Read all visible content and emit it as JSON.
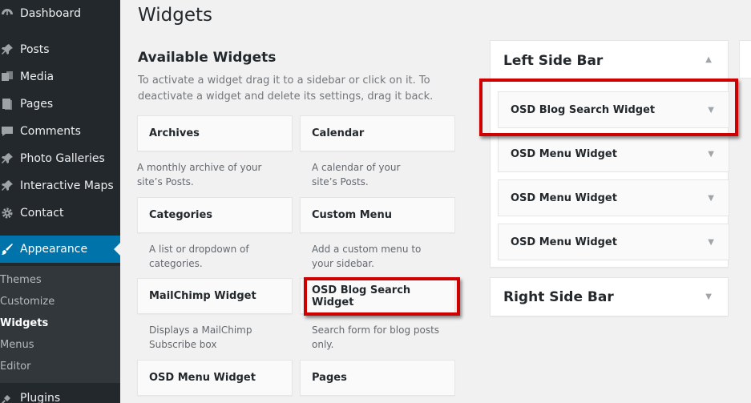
{
  "sidebar": {
    "items": [
      {
        "label": "Dashboard",
        "icon": "dashboard-icon"
      },
      {
        "label": "Posts",
        "icon": "pin-icon"
      },
      {
        "label": "Media",
        "icon": "media-icon"
      },
      {
        "label": "Pages",
        "icon": "pages-icon"
      },
      {
        "label": "Comments",
        "icon": "comments-icon"
      },
      {
        "label": "Photo Galleries",
        "icon": "pin-icon"
      },
      {
        "label": "Interactive Maps",
        "icon": "pin-icon"
      },
      {
        "label": "Contact",
        "icon": "gear-icon"
      },
      {
        "label": "Appearance",
        "icon": "brush-icon"
      },
      {
        "label": "Plugins",
        "icon": "plugin-icon"
      }
    ],
    "submenu": [
      "Themes",
      "Customize",
      "Widgets",
      "Menus",
      "Editor"
    ],
    "current_submenu": "Widgets"
  },
  "main": {
    "title": "Widgets",
    "available_heading": "Available Widgets",
    "available_description": "To activate a widget drag it to a sidebar or click on it. To deactivate a widget and delete its settings, drag it back.",
    "widgets": [
      {
        "name": "Archives",
        "description": "A monthly archive of your site’s Posts."
      },
      {
        "name": "Calendar",
        "description": "A calendar of your site’s Posts."
      },
      {
        "name": "Categories",
        "description": "A list or dropdown of categories."
      },
      {
        "name": "Custom Menu",
        "description": "Add a custom menu to your sidebar."
      },
      {
        "name": "MailChimp Widget",
        "description": "Displays a MailChimp Subscribe box"
      },
      {
        "name": "OSD Blog Search Widget",
        "description": "Search form for blog posts only."
      },
      {
        "name": "OSD Menu Widget",
        "description": ""
      },
      {
        "name": "Pages",
        "description": ""
      }
    ]
  },
  "sidebars": {
    "left": {
      "title": "Left Side Bar",
      "toggle": "▲",
      "widgets": [
        "OSD Blog Search Widget",
        "OSD Menu Widget",
        "OSD Menu Widget",
        "OSD Menu Widget"
      ]
    },
    "right": {
      "title": "Right Side Bar",
      "toggle": "▼"
    }
  },
  "widget_arrow": "▼",
  "colors": {
    "sidebar_bg": "#23282d",
    "active_menu": "#0073aa",
    "highlight": "#d10000"
  }
}
